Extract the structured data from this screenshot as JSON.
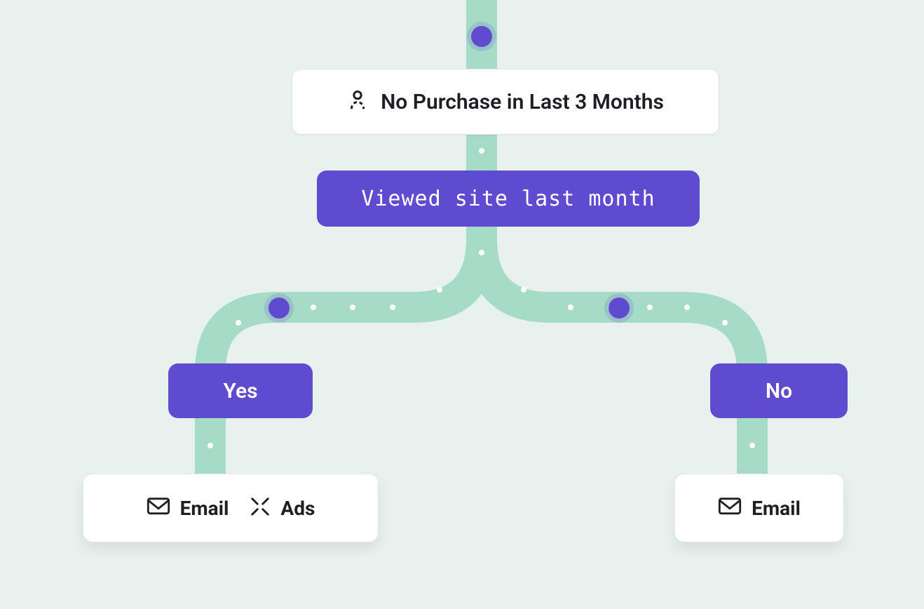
{
  "colors": {
    "background": "#e7f2ee",
    "accent": "#5f4bcf",
    "path": "#a6dbc7",
    "card_bg": "#ffffff",
    "text": "#1e1e24"
  },
  "flow": {
    "segment": {
      "icon": "person-icon",
      "label": "No Purchase in Last 3 Months"
    },
    "condition": {
      "label": "Viewed site last month"
    },
    "branches": {
      "yes": {
        "label": "Yes",
        "actions": [
          {
            "icon": "email-icon",
            "label": "Email"
          },
          {
            "icon": "ads-icon",
            "label": "Ads"
          }
        ]
      },
      "no": {
        "label": "No",
        "actions": [
          {
            "icon": "email-icon",
            "label": "Email"
          }
        ]
      }
    }
  }
}
